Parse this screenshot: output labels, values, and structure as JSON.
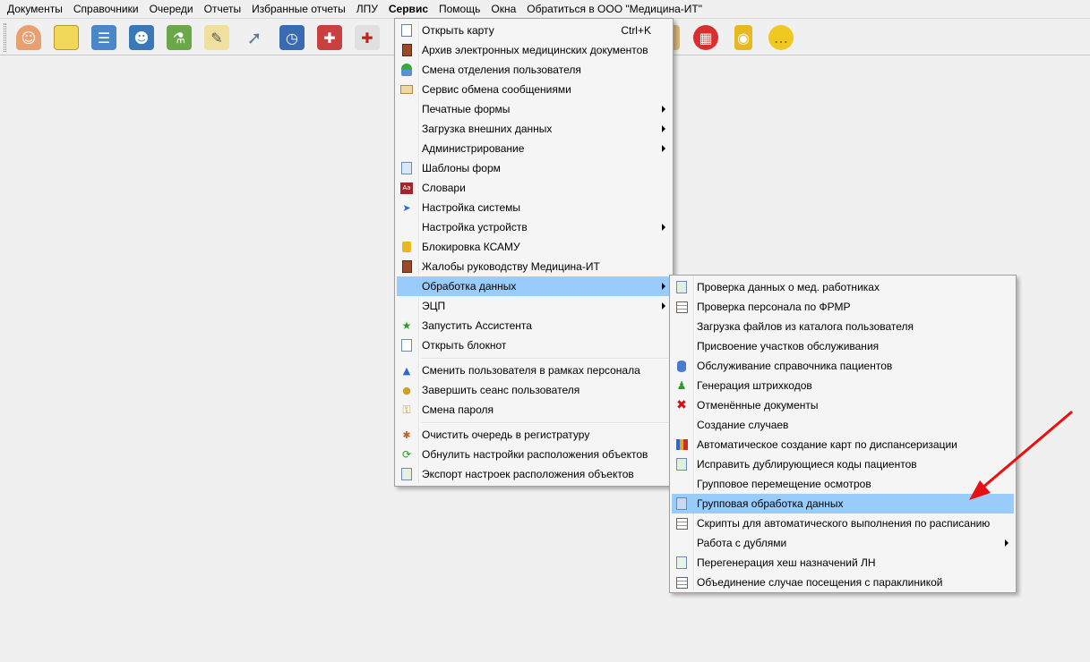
{
  "menubar": {
    "items": [
      "Документы",
      "Справочники",
      "Очереди",
      "Отчеты",
      "Избранные отчеты",
      "ЛПУ",
      "Сервис",
      "Помощь",
      "Окна",
      "Обратиться в ООО \"Медицина-ИТ\""
    ],
    "active": "Сервис"
  },
  "toolbar": {
    "icons": [
      "doctor-icon",
      "notepad-icon",
      "card-index-icon",
      "id-card-icon",
      "lab-flasks-icon",
      "edit-notes-icon",
      "syringe-icon",
      "schedule-clock-icon",
      "medicine-kit-icon",
      "medical-case-icon",
      "blank-icon",
      "book-icon",
      "apps-grid-icon",
      "lock-icon",
      "chat-bubble-icon"
    ]
  },
  "service_menu": {
    "items": [
      {
        "label": "Открыть карту",
        "shortcut": "Ctrl+K",
        "icon": "card-icon"
      },
      {
        "label": "Архив электронных медицинских документов",
        "icon": "book-icon"
      },
      {
        "label": "Смена отделения пользователя",
        "icon": "person-icon"
      },
      {
        "label": "Сервис обмена сообщениями",
        "icon": "envelope-icon"
      },
      {
        "label": "Печатные формы",
        "submenu": true
      },
      {
        "label": "Загрузка внешних данных",
        "submenu": true
      },
      {
        "label": "Администрирование",
        "submenu": true
      },
      {
        "label": "Шаблоны форм",
        "icon": "template-icon"
      },
      {
        "label": "Словари",
        "icon": "dictionary-icon"
      },
      {
        "label": "Настройка системы",
        "icon": "settings-arrow-icon"
      },
      {
        "label": "Настройка устройств",
        "submenu": true
      },
      {
        "label": "Блокировка КСАМУ",
        "icon": "lock-icon"
      },
      {
        "label": "Жалобы руководству Медицина-ИТ",
        "icon": "book-icon"
      },
      {
        "label": "Обработка данных",
        "submenu": true,
        "highlighted": true
      },
      {
        "label": "ЭЦП",
        "submenu": true
      },
      {
        "label": "Запустить Ассистента",
        "icon": "assistant-icon"
      },
      {
        "label": "Открыть блокнот",
        "icon": "notepad-icon"
      },
      {
        "label": "Сменить пользователя в рамках персонала",
        "icon": "user-switch-icon"
      },
      {
        "label": "Завершить сеанс пользователя",
        "icon": "logout-icon"
      },
      {
        "label": "Смена пароля",
        "icon": "key-icon"
      },
      {
        "label": "Очистить очередь в регистратуру",
        "icon": "clear-icon"
      },
      {
        "label": "Обнулить настройки расположения объектов",
        "icon": "reset-icon"
      },
      {
        "label": "Экспорт настроек расположения объектов",
        "icon": "export-icon"
      }
    ]
  },
  "data_processing_submenu": {
    "items": [
      {
        "label": "Проверка данных о мед. работниках",
        "icon": "check-doc-icon"
      },
      {
        "label": "Проверка персонала по ФРМР",
        "icon": "grid-icon"
      },
      {
        "label": "Загрузка файлов из каталога пользователя"
      },
      {
        "label": "Присвоение участков обслуживания"
      },
      {
        "label": "Обслуживание справочника пациентов",
        "icon": "database-icon"
      },
      {
        "label": "Генерация штрихкодов",
        "icon": "people-icon"
      },
      {
        "label": "Отменённые документы",
        "icon": "red-x-icon"
      },
      {
        "label": "Создание случаев"
      },
      {
        "label": "Автоматическое создание карт по диспансеризации",
        "icon": "chart-icon"
      },
      {
        "label": "Исправить дублирующиеся коды пациентов",
        "icon": "check-doc-icon"
      },
      {
        "label": "Групповое перемещение осмотров"
      },
      {
        "label": "Групповая обработка данных",
        "icon": "copy-icon",
        "highlighted": true
      },
      {
        "label": "Скрипты для автоматического выполнения по расписанию",
        "icon": "grid-icon"
      },
      {
        "label": "Работа с дублями",
        "submenu": true
      },
      {
        "label": "Перегенерация хеш назначений ЛН",
        "icon": "doc-plus-icon"
      },
      {
        "label": "Объединение случае посещения с параклиникой",
        "icon": "grid-icon"
      }
    ]
  },
  "colors": {
    "highlight": "#99ccfa",
    "annotation_arrow": "#e81010"
  }
}
